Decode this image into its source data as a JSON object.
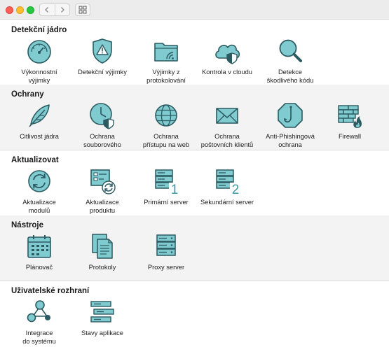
{
  "window": {
    "icons": [
      "close-button",
      "minimize-button",
      "zoom-button",
      "back-icon",
      "forward-icon",
      "grid-icon"
    ]
  },
  "colors": {
    "icon_fill": "#7fcbd0",
    "icon_stroke": "#2b5b61",
    "section_gray": "#f3f3f3"
  },
  "sections": [
    {
      "title": "Detekční jádro",
      "items": [
        {
          "label": "Výkonnostní\nvýjimky",
          "icon": "speedometer-icon"
        },
        {
          "label": "Detekční výjimky",
          "icon": "warning-shield-icon"
        },
        {
          "label": "Výjimky z\nprotokolování",
          "icon": "folder-wifi-icon"
        },
        {
          "label": "Kontrola v cloudu",
          "icon": "cloud-shield-icon"
        },
        {
          "label": "Detekce\nškodlivého kódu",
          "icon": "magnifier-icon"
        }
      ]
    },
    {
      "title": "Ochrany",
      "items": [
        {
          "label": "Citlivost jádra",
          "icon": "feather-icon"
        },
        {
          "label": "Ochrana\nsouborového",
          "icon": "clock-shield-icon"
        },
        {
          "label": "Ochrana\npřístupu na web",
          "icon": "globe-icon"
        },
        {
          "label": "Ochrana\npoštovních klientů",
          "icon": "envelope-icon"
        },
        {
          "label": "Anti-Phishingová\nochrana",
          "icon": "hook-icon"
        },
        {
          "label": "Firewall",
          "icon": "firewall-icon"
        }
      ]
    },
    {
      "title": "Aktualizovat",
      "items": [
        {
          "label": "Aktualizace\nmodulů",
          "icon": "refresh-icon"
        },
        {
          "label": "Aktualizace\nproduktu",
          "icon": "product-update-icon"
        },
        {
          "label": "Primární server",
          "icon": "server-1-icon",
          "badge": "1"
        },
        {
          "label": "Sekundární server",
          "icon": "server-2-icon",
          "badge": "2"
        }
      ]
    },
    {
      "title": "Nástroje",
      "items": [
        {
          "label": "Plánovač",
          "icon": "calendar-icon"
        },
        {
          "label": "Protokoly",
          "icon": "documents-icon"
        },
        {
          "label": "Proxy server",
          "icon": "proxy-server-icon"
        }
      ]
    },
    {
      "title": "Uživatelské rozhraní",
      "items": [
        {
          "label": "Integrace\ndo systému",
          "icon": "share-nodes-icon"
        },
        {
          "label": "Stavy aplikace",
          "icon": "status-list-icon"
        }
      ]
    }
  ]
}
